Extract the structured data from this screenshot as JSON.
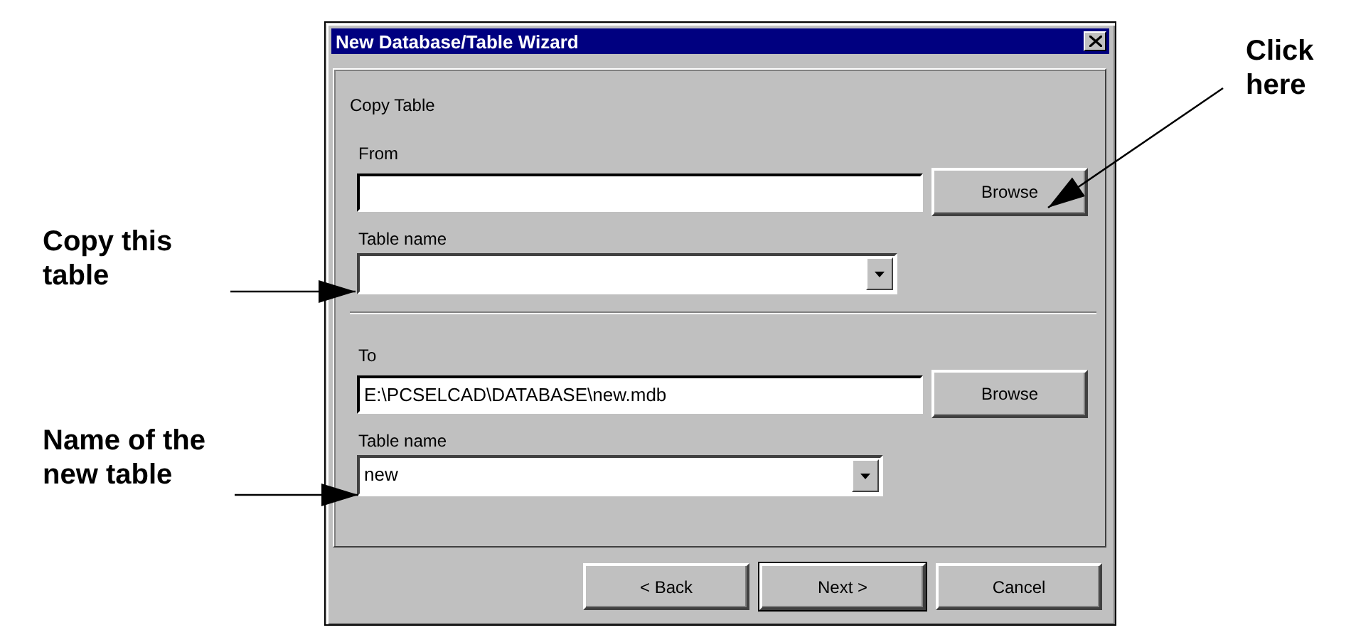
{
  "window": {
    "title": "New Database/Table Wizard"
  },
  "section_title": "Copy Table",
  "source": {
    "label": "From",
    "browse": "Browse",
    "table_label": "Table name"
  },
  "destination": {
    "label": "To",
    "value": "E:\\PCSELCAD\\DATABASE\\new.mdb",
    "browse": "Browse",
    "table_label": "Table name",
    "table_value": "new"
  },
  "buttons": [
    {
      "label": "< Back",
      "default": false
    },
    {
      "label": "Next >",
      "default": true
    },
    {
      "label": "Cancel",
      "default": false
    }
  ],
  "annotations": [
    {
      "text": "Click here"
    },
    {
      "text": "Copy this table"
    },
    {
      "text": "Name of the new table"
    }
  ]
}
